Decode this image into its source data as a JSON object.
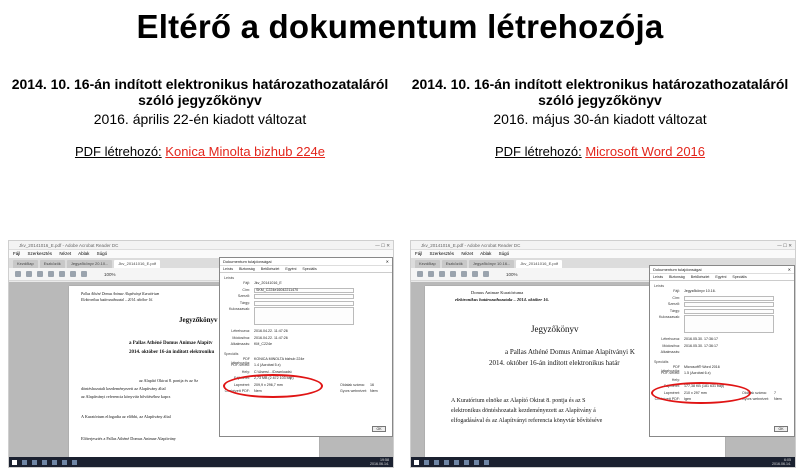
{
  "slide_title": "Eltérő a dokumentum létrehozója",
  "left": {
    "doc_title_line1": "2014. 10. 16-án indított elektronikus határozathozataláról",
    "doc_title_line2": "szóló jegyzőkönyv",
    "version": "2016. április 22-én kiadott változat",
    "creator_label": "PDF létrehozó:",
    "creator_value": "Konica Minolta bizhub 224e"
  },
  "right": {
    "doc_title_line1": "2014. 10. 16-án indított elektronikus határozathozataláról",
    "doc_title_line2": "szóló jegyzőkönyv",
    "version": "2016. május 30-án kiadott változat",
    "creator_label": "PDF létrehozó:",
    "creator_value": "Microsoft Word 2016"
  },
  "shot_left": {
    "window_title": "Jkv_20141016_E.pdf - Adobe Acrobat Reader DC",
    "menu": [
      "Fájl",
      "Szerkesztés",
      "Nézet",
      "Ablak",
      "Súgó"
    ],
    "tabs": [
      "Kezdőlap",
      "Eszközök",
      "Jegyzőkönyv 20.10...",
      "Jkv_20141016_E.pdf"
    ],
    "zoom": "100%",
    "page_header_1": "Pallas Athéné Domus Animae Alapítványi Kuratórium",
    "page_header_2": "Elektronikus határozathozatal – 2014. október 16.",
    "page_heading": "Jegyzőkönyv",
    "page_line_1": "a Pallas Athéné Domus Animae Alapítv",
    "page_line_2": "2014. október 16-án indított elektroniku",
    "page_para_1": "az Alapító Okirat 8. pontja és az Sz",
    "page_para_2": "döntéshozatalt kezdeményezett az Alapítvány által",
    "page_para_3": "az Alapítványi referencia könyvtár bővítéséhez kapcs",
    "page_para_4": "A Kuratórium elfogadta az előbbi, az Alapítvány által",
    "page_para_5": "Előterjesztés a Pallas Athéné Domus Animae Alapítvány",
    "dialog": {
      "title": "Dokumentum tulajdonságai",
      "tabs": [
        "Leírás",
        "Biztonság",
        "Betűkészlet",
        "Egyéni",
        "Speciális"
      ],
      "section": "Leírás",
      "fajl_label": "Fájl:",
      "fajl_value": "Jkv_20141016_E",
      "cim_label": "Cím:",
      "cim_value": "SKM_C224e16042211470",
      "szerzo_label": "Szerző:",
      "targy_label": "Tárgy:",
      "kulcsszavak_label": "Kulcsszavak:",
      "letrehozva_label": "Létrehozva:",
      "letrehozva_value": "2016.04.22. 11:47:26",
      "modositva_label": "Módosítva:",
      "modositva_value": "2016.04.22. 11:47:26",
      "alkalmazas_label": "Alkalmazás:",
      "alkalmazas_value": "KM_C224e",
      "specialis_label": "Speciális",
      "pdf_letrehozo_label": "PDF létrehozója:",
      "pdf_letrehozo_value": "KONICA MINOLTA bizhub 224e",
      "pdf_verzio_label": "PDF-verzió:",
      "pdf_verzio_value": "1.4 (Acrobat 5.x)",
      "hely_label": "Hely:",
      "hely_value": "C:\\Users\\...\\Downloads\\",
      "fajlmeret_label": "Fájlméret:",
      "fajlmeret_value": "2,73 MB (2 872 103 bájt)",
      "lapmeret_label": "Lapméret:",
      "lapmeret_value": "209,9 x 296,7 mm",
      "oldalak_label": "Oldalak száma:",
      "oldalak_value": "16",
      "cimkezett_label": "Címkézett PDF:",
      "cimkezett_value": "Nem",
      "gyors_label": "Gyors webnézet:",
      "gyors_value": "Nem",
      "ok": "OK"
    },
    "clock_time": "19:58",
    "clock_date": "2016.06.14."
  },
  "shot_right": {
    "window_title": "Jkv_20141016_E.pdf - Adobe Acrobat Reader DC",
    "menu": [
      "Fájl",
      "Szerkesztés",
      "Nézet",
      "Ablak",
      "Súgó"
    ],
    "tabs": [
      "Kezdőlap",
      "Eszközök",
      "Jegyzőkönyv 10.16...",
      "Jkv_20141016_E.pdf"
    ],
    "zoom": "100%",
    "page_header_1": "Domus Animae                    Kuratóriuma",
    "page_header_2": "elektronikus határozathozatala – 2014. október 16.",
    "page_heading": "Jegyzőkönyv",
    "page_line_1": "a Pallas Athéné Domus Animae Alapítványi K",
    "page_line_2": "2014. október 16-án indított elektronikus határ",
    "page_para_1": "A Kuratórium elnöke az Alapító Okirat 8. pontja és az S",
    "page_para_2": "elektronikus döntéshozatalt kezdeményezett az Alapítvány á",
    "page_para_3": "elfogadásával és az Alapítványi referencia könyvtár bővítéséve",
    "dialog": {
      "title": "Dokumentum tulajdonságai",
      "tabs": [
        "Leírás",
        "Biztonság",
        "Betűkészlet",
        "Egyéni",
        "Speciális"
      ],
      "section": "Leírás",
      "fajl_label": "Fájl:",
      "fajl_value": "Jegyzőkönyv 10.16.",
      "cim_label": "Cím:",
      "szerzo_label": "Szerző:",
      "targy_label": "Tárgy:",
      "kulcsszavak_label": "Kulcsszavak:",
      "letrehozva_label": "Létrehozva:",
      "letrehozva_value": "2016.05.30. 17:36:17",
      "modositva_label": "Módosítva:",
      "modositva_value": "2016.05.30. 17:36:17",
      "alkalmazas_label": "Alkalmazás:",
      "specialis_label": "Speciális",
      "pdf_letrehozo_label": "PDF létrehozója:",
      "pdf_letrehozo_value": "Microsoft® Word 2016",
      "pdf_verzio_label": "PDF-verzió:",
      "pdf_verzio_value": "1.5 (Acrobat 6.x)",
      "hely_label": "Hely:",
      "fajlmeret_label": "Fájlméret:",
      "fajlmeret_value": "177,38 KB (181 631 bájt)",
      "lapmeret_label": "Lapméret:",
      "lapmeret_value": "210 x 297 mm",
      "oldalak_label": "Oldalak száma:",
      "oldalak_value": "7",
      "cimkezett_label": "Címkézett PDF:",
      "cimkezett_value": "Igen",
      "gyors_label": "Gyors webnézet:",
      "gyors_value": "Nem",
      "ok": "OK"
    },
    "clock_time": "6:05",
    "clock_date": "2016.06.14."
  }
}
